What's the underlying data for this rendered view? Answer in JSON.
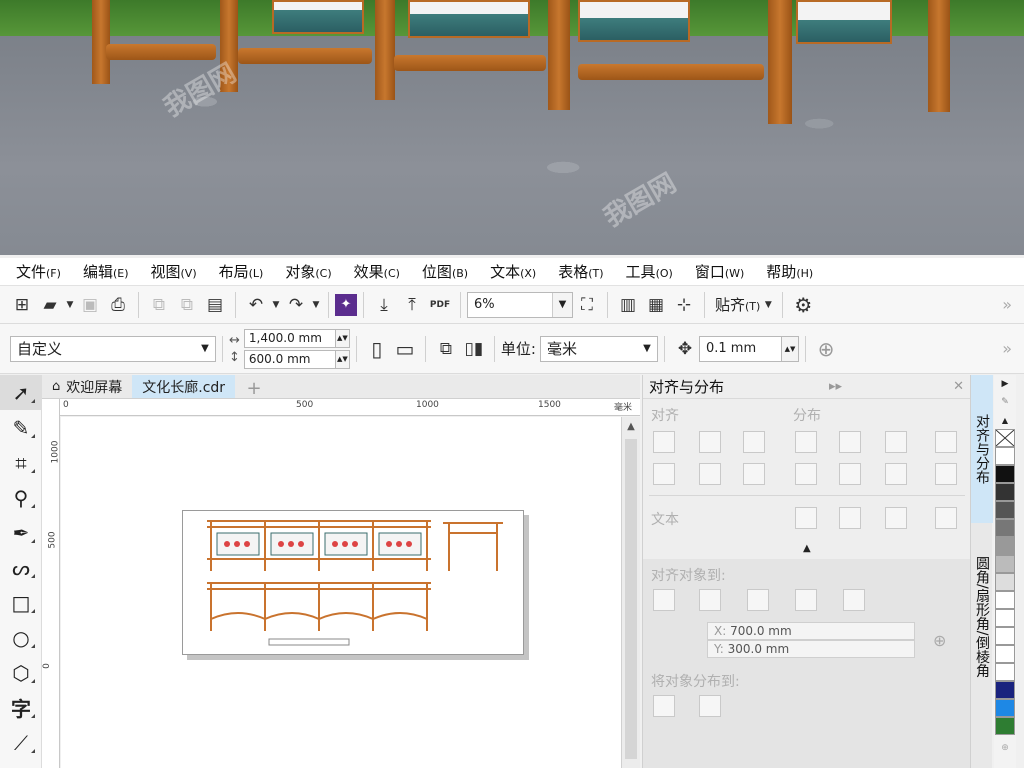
{
  "menu": [
    {
      "label": "文件",
      "key": "(F)"
    },
    {
      "label": "编辑",
      "key": "(E)"
    },
    {
      "label": "视图",
      "key": "(V)"
    },
    {
      "label": "布局",
      "key": "(L)"
    },
    {
      "label": "对象",
      "key": "(C)"
    },
    {
      "label": "效果",
      "key": "(C)"
    },
    {
      "label": "位图",
      "key": "(B)"
    },
    {
      "label": "文本",
      "key": "(X)"
    },
    {
      "label": "表格",
      "key": "(T)"
    },
    {
      "label": "工具",
      "key": "(O)"
    },
    {
      "label": "窗口",
      "key": "(W)"
    },
    {
      "label": "帮助",
      "key": "(H)"
    }
  ],
  "standard_toolbar": {
    "zoom": "6%",
    "snap_label": "贴齐",
    "snap_key": "(T)",
    "pdf_label": "PDF"
  },
  "property_bar": {
    "page_size": "自定义",
    "width": "1,400.0 mm",
    "height": "600.0 mm",
    "units_label": "单位:",
    "units": "毫米",
    "nudge": "0.1 mm"
  },
  "tabs": {
    "home": "欢迎屏幕",
    "document": "文化长廊.cdr"
  },
  "rulers": {
    "h_ticks": [
      "0",
      "500",
      "1000",
      "1500"
    ],
    "h_unit": "毫米",
    "v_ticks": [
      "1000",
      "500",
      "0"
    ]
  },
  "docker": {
    "title": "对齐与分布",
    "align_label": "对齐",
    "distribute_label": "分布",
    "text_label": "文本",
    "align_to_label": "对齐对象到:",
    "x_label": "X:",
    "x_value": "700.0 mm",
    "y_label": "Y:",
    "y_value": "300.0 mm",
    "distribute_to_label": "将对象分布到:"
  },
  "docker_tabs": [
    "对齐与分布",
    "圆角/扇形角/倒棱角"
  ],
  "palette_colors": [
    "#ffffff",
    "#111111",
    "#333333",
    "#555555",
    "#777777",
    "#999999",
    "#bbbbbb",
    "#dddddd",
    "#ffffff",
    "#ffffff",
    "#ffffff",
    "#ffffff",
    "#ffffff",
    "#1a237e",
    "#1e88e5",
    "#2e7d32"
  ],
  "watermark": "我图网"
}
